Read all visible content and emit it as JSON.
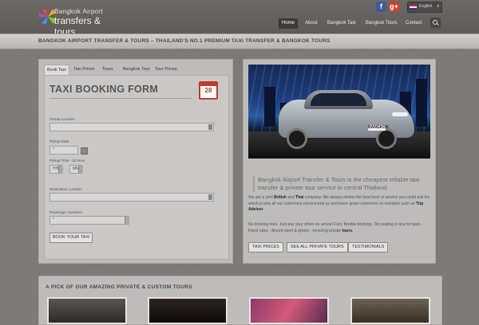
{
  "header": {
    "logo_line1": "Bangkok Airport",
    "logo_line2": "transfers & tours",
    "social": [
      {
        "label": "f",
        "icon": "facebook-icon"
      },
      {
        "label": "g+",
        "icon": "google-plus-icon"
      }
    ],
    "language": "English",
    "nav": [
      "Home",
      "About",
      "Bangkok Taxi",
      "Bangkok Tours",
      "Contact"
    ],
    "active_nav": "Home"
  },
  "banner": "BANGKOK AIRPORT TRANSFER & TOURS – THAILAND'S NO.1 PREMIUM TAXI TRANSFER & BANGKOK TOURS",
  "booking": {
    "tabs": [
      "Book Taxi",
      "Taxi Prices",
      "Tours",
      "Bangkok Tour",
      "Tour Prices"
    ],
    "active_tab": "Book Taxi",
    "title": "TAXI BOOKING FORM",
    "calendar_day": "28",
    "pickup_location_label": "Pickup Location",
    "pickup_date_label": "Pickup Date",
    "pickup_date_value": "*",
    "pickup_time_label": "Pickup Time - 24 Hour",
    "hour_value": "HH",
    "minute_value": "MM",
    "destination_label": "Destination Location",
    "passengers_label": "Passenger Numbers",
    "passengers_value": "*",
    "submit_label": "BOOK YOUR TAXI"
  },
  "promo": {
    "plate_text": "BANGKOK",
    "quote": "Bangkok Airport Transfer & Tours is the cheapest reliable taxi transfer & private tour service in central Thailand.",
    "para1_a": "We are a joint ",
    "para1_b": "British",
    "para1_c": " and ",
    "para1_d": "Thai",
    "para1_e": " company. We always deliver the best level of service you could ask for, which is why all our customers recommend us and leave great comments on websites such as ",
    "para1_f": "Trip Advisor",
    "para1_g": ".",
    "para2_a": "No booking fees. Just pay your driver on arrival! Fast, flexible booking - No waiting in line for taxis - Fixed rates - Airport meet & greets - Amazing private ",
    "para2_b": "tours",
    "para2_c": ".",
    "buttons": [
      "TAXI PRICES",
      "SEE ALL PRIVATE TOURS",
      "TESTIMONIALS"
    ]
  },
  "tours": {
    "title": "A PICK OF OUR AMAZING PRIVATE & CUSTOM TOURS"
  }
}
